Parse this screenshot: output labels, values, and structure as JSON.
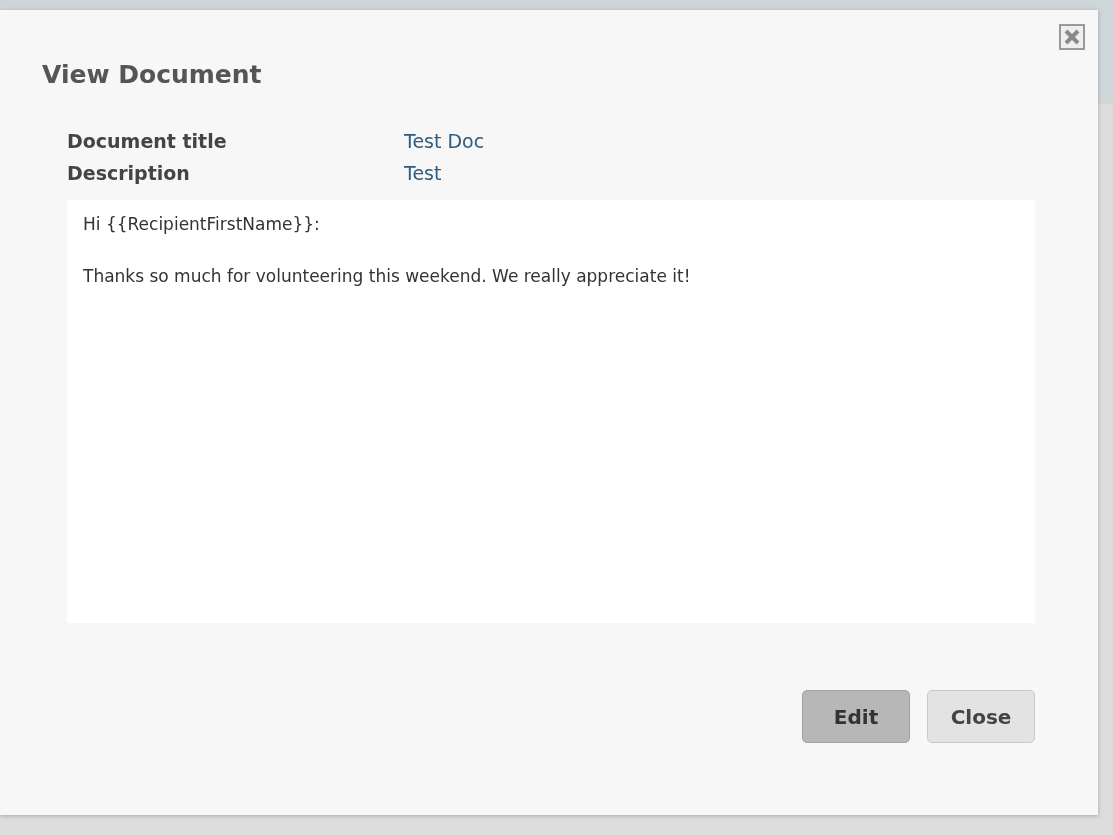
{
  "dialog": {
    "title": "View Document",
    "fields": [
      {
        "label": "Document title",
        "value": "Test Doc"
      },
      {
        "label": "Description",
        "value": "Test"
      }
    ],
    "body": [
      "Hi {{RecipientFirstName}}:",
      "Thanks so much for volunteering this weekend. We really appreciate it!"
    ],
    "buttons": [
      {
        "label": "Edit",
        "kind": "primary"
      },
      {
        "label": "Close",
        "kind": "default"
      }
    ]
  }
}
